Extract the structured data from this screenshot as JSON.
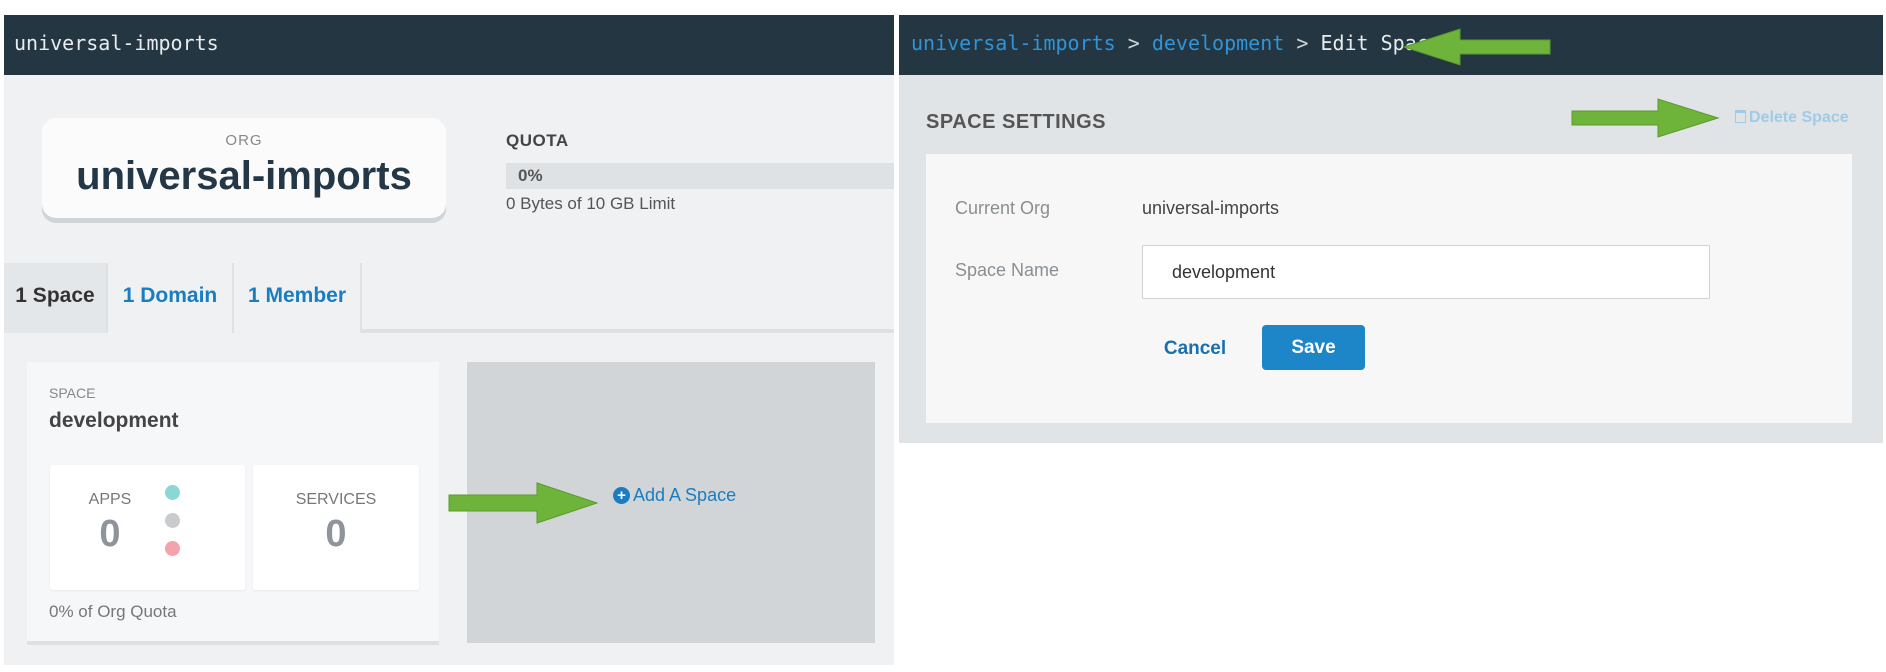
{
  "left": {
    "header_title": "universal-imports",
    "org_card": {
      "label": "ORG",
      "name": "universal-imports"
    },
    "quota": {
      "title": "QUOTA",
      "percent": "0%",
      "fraction": 0,
      "limit_text": "0 Bytes of 10 GB Limit"
    },
    "tabs": [
      {
        "label": "1 Space",
        "active": true
      },
      {
        "label": "1 Domain",
        "active": false
      },
      {
        "label": "1 Member",
        "active": false
      }
    ],
    "space_card": {
      "label": "SPACE",
      "name": "development",
      "apps": {
        "label": "APPS",
        "value": "0"
      },
      "services": {
        "label": "SERVICES",
        "value": "0"
      },
      "status_dot_colors": [
        "#8ad7d6",
        "#c9cbcd",
        "#f4a3ac"
      ],
      "org_quota_text": "0% of Org Quota"
    },
    "add_space_label": "Add A Space"
  },
  "right": {
    "breadcrumb": [
      {
        "label": "universal-imports",
        "link": true
      },
      {
        "label": "development",
        "link": true
      },
      {
        "label": "Edit Space",
        "link": false
      }
    ],
    "breadcrumb_separator": ">",
    "settings_title": "SPACE SETTINGS",
    "delete_label": "Delete Space",
    "form": {
      "current_org_label": "Current Org",
      "current_org_value": "universal-imports",
      "space_name_label": "Space Name",
      "space_name_value": "development",
      "cancel_label": "Cancel",
      "save_label": "Save"
    }
  },
  "colors": {
    "header_bg": "#233641",
    "link_blue": "#1a7dc2",
    "primary_button": "#1d86c8",
    "annotation_arrow": "#6fb43a"
  },
  "icons": [
    "plus-circle-icon",
    "trash-icon",
    "arrow-annotation-icon"
  ]
}
